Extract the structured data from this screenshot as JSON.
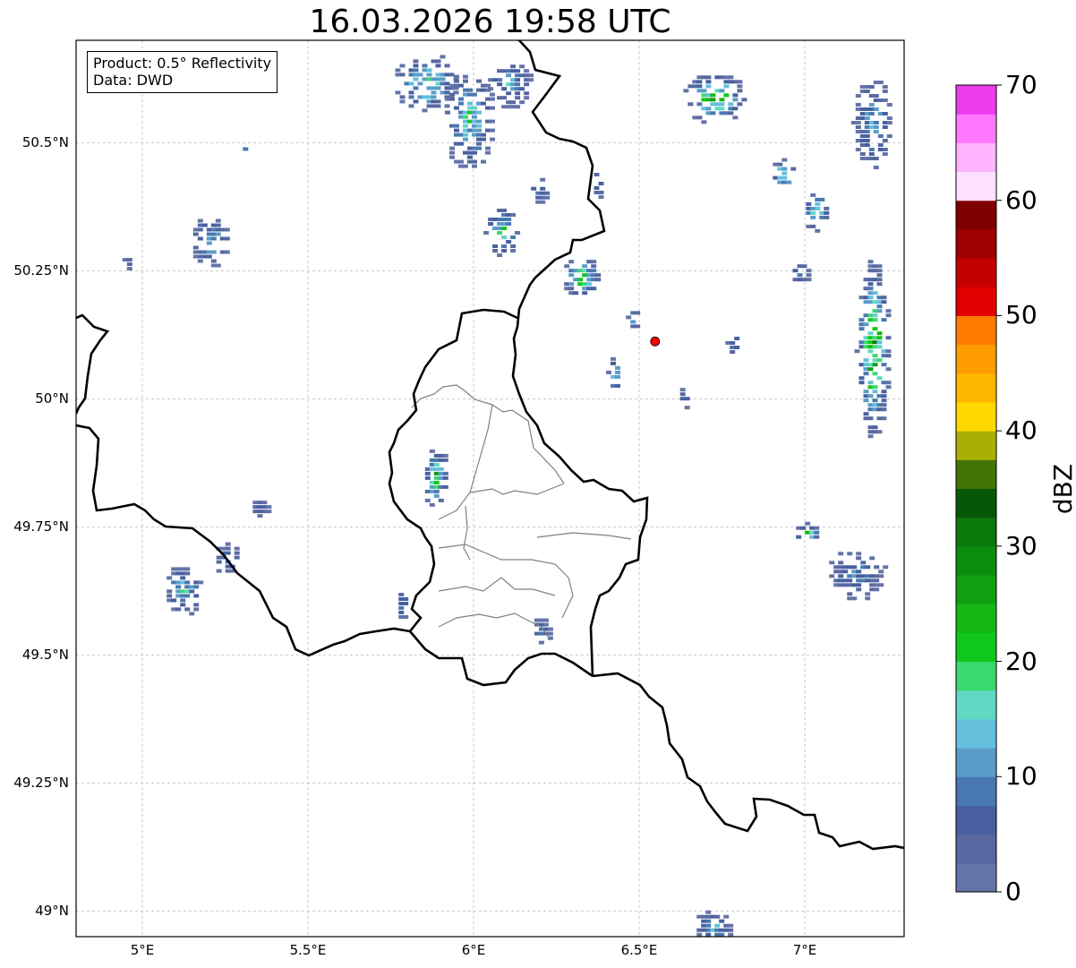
{
  "title": "16.03.2026 19:58 UTC",
  "info": {
    "product": "Product: 0.5° Reflectivity",
    "data": "Data: DWD"
  },
  "map": {
    "lon_range": [
      4.8,
      7.3
    ],
    "lat_range": [
      48.95,
      50.7
    ],
    "grid": true,
    "lat_ticks": [
      {
        "value": 50.5,
        "label": "50.5°N"
      },
      {
        "value": 50.25,
        "label": "50.25°N"
      },
      {
        "value": 50.0,
        "label": "50°N"
      },
      {
        "value": 49.75,
        "label": "49.75°N"
      },
      {
        "value": 49.5,
        "label": "49.5°N"
      },
      {
        "value": 49.25,
        "label": "49.25°N"
      },
      {
        "value": 49.0,
        "label": "49°N"
      }
    ],
    "lon_ticks": [
      {
        "value": 5.0,
        "label": "5°E"
      },
      {
        "value": 5.5,
        "label": "5.5°E"
      },
      {
        "value": 6.0,
        "label": "6°E"
      },
      {
        "value": 6.5,
        "label": "6.5°E"
      },
      {
        "value": 7.0,
        "label": "7°E"
      }
    ],
    "radar_site": {
      "lon": 6.548,
      "lat": 50.112,
      "color": "#ff0000"
    }
  },
  "colorbar": {
    "label": "dBZ",
    "min": 0,
    "max": 70,
    "step": 2.5,
    "tick_values": [
      0,
      10,
      20,
      30,
      40,
      50,
      60,
      70
    ],
    "tick_labels": [
      "0",
      "10",
      "20",
      "30",
      "40",
      "50",
      "60",
      "70"
    ],
    "colors": [
      "#6474a8",
      "#5868a0",
      "#4860a0",
      "#4a78b0",
      "#5a9cc8",
      "#64c0dc",
      "#60d8c4",
      "#3cd870",
      "#10c81c",
      "#14b814",
      "#10a010",
      "#0c8c0c",
      "#0a780a",
      "#065806",
      "#427604",
      "#a8b004",
      "#ffd800",
      "#ffb800",
      "#ff9c00",
      "#ff7c00",
      "#e40000",
      "#c40000",
      "#a00000",
      "#800000",
      "#ffe0ff",
      "#ffb4ff",
      "#ff78ff",
      "#ec3cec"
    ]
  },
  "echoes": [
    {
      "lon": 5.85,
      "lat": 50.62,
      "rx": 0.1,
      "ry": 0.06,
      "max_dbz": 22
    },
    {
      "lon": 5.98,
      "lat": 50.55,
      "rx": 0.08,
      "ry": 0.1,
      "max_dbz": 20
    },
    {
      "lon": 6.1,
      "lat": 50.62,
      "rx": 0.07,
      "ry": 0.05,
      "max_dbz": 15
    },
    {
      "lon": 6.08,
      "lat": 50.33,
      "rx": 0.05,
      "ry": 0.05,
      "max_dbz": 22
    },
    {
      "lon": 6.19,
      "lat": 50.41,
      "rx": 0.03,
      "ry": 0.03,
      "max_dbz": 12
    },
    {
      "lon": 6.32,
      "lat": 50.24,
      "rx": 0.06,
      "ry": 0.04,
      "max_dbz": 25
    },
    {
      "lon": 6.37,
      "lat": 50.42,
      "rx": 0.02,
      "ry": 0.03,
      "max_dbz": 10
    },
    {
      "lon": 5.2,
      "lat": 50.31,
      "rx": 0.06,
      "ry": 0.05,
      "max_dbz": 18
    },
    {
      "lon": 4.95,
      "lat": 50.28,
      "rx": 0.01,
      "ry": 0.03,
      "max_dbz": 8
    },
    {
      "lon": 5.3,
      "lat": 50.49,
      "rx": 0.01,
      "ry": 0.01,
      "max_dbz": 12
    },
    {
      "lon": 6.72,
      "lat": 50.59,
      "rx": 0.1,
      "ry": 0.05,
      "max_dbz": 28
    },
    {
      "lon": 6.93,
      "lat": 50.44,
      "rx": 0.04,
      "ry": 0.03,
      "max_dbz": 25
    },
    {
      "lon": 7.03,
      "lat": 50.37,
      "rx": 0.04,
      "ry": 0.04,
      "max_dbz": 22
    },
    {
      "lon": 7.2,
      "lat": 50.54,
      "rx": 0.06,
      "ry": 0.09,
      "max_dbz": 15
    },
    {
      "lon": 7.2,
      "lat": 50.1,
      "rx": 0.05,
      "ry": 0.18,
      "max_dbz": 32
    },
    {
      "lon": 6.98,
      "lat": 50.25,
      "rx": 0.03,
      "ry": 0.03,
      "max_dbz": 10
    },
    {
      "lon": 6.48,
      "lat": 50.16,
      "rx": 0.02,
      "ry": 0.02,
      "max_dbz": 22
    },
    {
      "lon": 6.42,
      "lat": 50.05,
      "rx": 0.02,
      "ry": 0.04,
      "max_dbz": 20
    },
    {
      "lon": 6.63,
      "lat": 50.0,
      "rx": 0.02,
      "ry": 0.03,
      "max_dbz": 8
    },
    {
      "lon": 6.78,
      "lat": 50.11,
      "rx": 0.02,
      "ry": 0.02,
      "max_dbz": 15
    },
    {
      "lon": 5.88,
      "lat": 49.85,
      "rx": 0.04,
      "ry": 0.06,
      "max_dbz": 25
    },
    {
      "lon": 5.35,
      "lat": 49.79,
      "rx": 0.03,
      "ry": 0.02,
      "max_dbz": 10
    },
    {
      "lon": 5.12,
      "lat": 49.63,
      "rx": 0.06,
      "ry": 0.05,
      "max_dbz": 18
    },
    {
      "lon": 5.25,
      "lat": 49.69,
      "rx": 0.04,
      "ry": 0.03,
      "max_dbz": 12
    },
    {
      "lon": 5.78,
      "lat": 49.6,
      "rx": 0.02,
      "ry": 0.03,
      "max_dbz": 15
    },
    {
      "lon": 7.0,
      "lat": 49.74,
      "rx": 0.04,
      "ry": 0.02,
      "max_dbz": 25
    },
    {
      "lon": 7.15,
      "lat": 49.66,
      "rx": 0.09,
      "ry": 0.05,
      "max_dbz": 12
    },
    {
      "lon": 6.72,
      "lat": 48.97,
      "rx": 0.06,
      "ry": 0.04,
      "max_dbz": 15
    },
    {
      "lon": 6.2,
      "lat": 49.55,
      "rx": 0.03,
      "ry": 0.03,
      "max_dbz": 8
    }
  ]
}
